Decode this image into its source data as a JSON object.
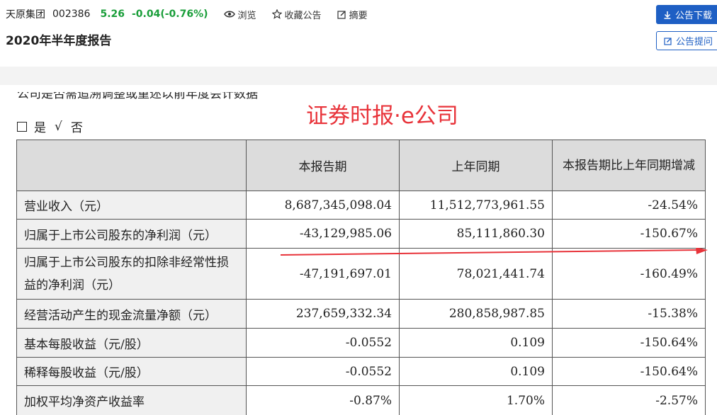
{
  "header": {
    "company": "天原集团",
    "code": "002386",
    "price": "5.26",
    "change": "-0.04(-0.76%)",
    "actions": {
      "browse": "浏览",
      "favorite": "收藏公告",
      "summary": "摘要"
    },
    "report_title": "2020年半年度报告",
    "download_label": "公告下载",
    "ask_label": "公告提问"
  },
  "doc": {
    "cut_text": "公司是否需追溯调整或重述以前年度会计数据",
    "yes_label": "是",
    "check_mark": "√",
    "no_label": "否",
    "watermark": "证券时报·e公司"
  },
  "table": {
    "headers": [
      "",
      "本报告期",
      "上年同期",
      "本报告期比上年同期增减"
    ],
    "rows": [
      {
        "label": "营业收入（元）",
        "current": "8,687,345,098.04",
        "previous": "11,512,773,961.55",
        "change": "-24.54%"
      },
      {
        "label": "归属于上市公司股东的净利润（元）",
        "current": "-43,129,985.06",
        "previous": "85,111,860.30",
        "change": "-150.67%"
      },
      {
        "label": "归属于上市公司股东的扣除非经常性损益的净利润（元）",
        "current": "-47,191,697.01",
        "previous": "78,021,441.74",
        "change": "-160.49%"
      },
      {
        "label": "经营活动产生的现金流量净额（元）",
        "current": "237,659,332.34",
        "previous": "280,858,987.85",
        "change": "-15.38%"
      },
      {
        "label": "基本每股收益（元/股）",
        "current": "-0.0552",
        "previous": "0.109",
        "change": "-150.64%"
      },
      {
        "label": "稀释每股收益（元/股）",
        "current": "-0.0552",
        "previous": "0.109",
        "change": "-150.64%"
      },
      {
        "label": "加权平均净资产收益率",
        "current": "-0.87%",
        "previous": "1.70%",
        "change": "-2.57%"
      }
    ]
  },
  "colors": {
    "accent": "#1e5fc4",
    "price_green": "#1a9e3a",
    "watermark_red": "#e8333a"
  }
}
